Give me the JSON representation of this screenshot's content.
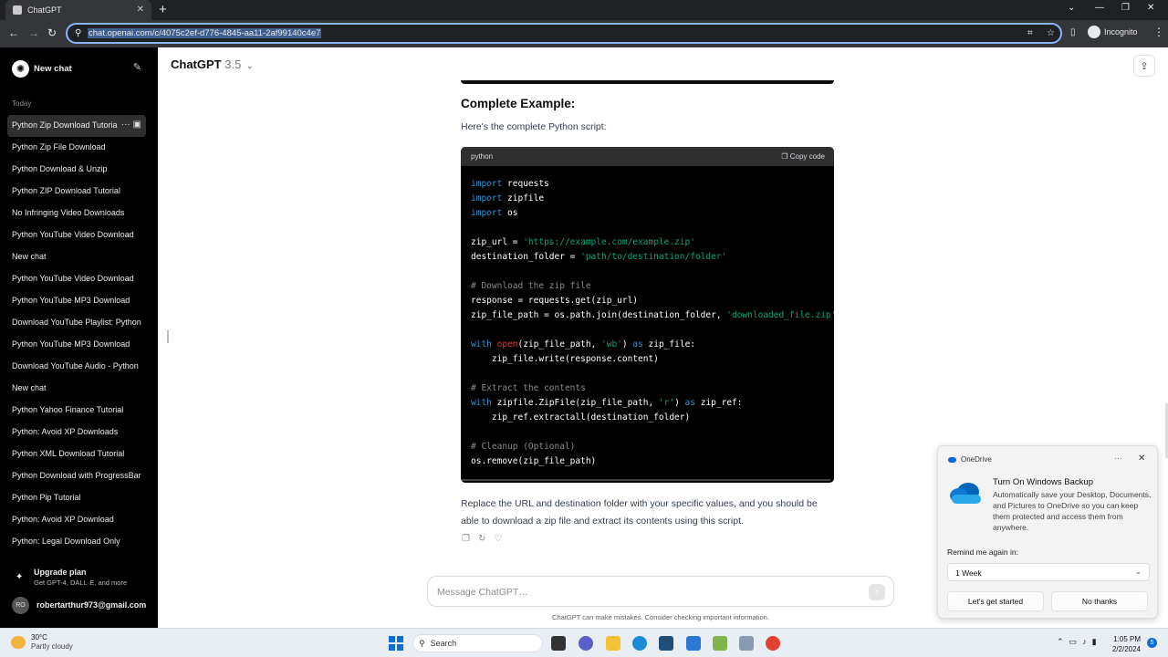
{
  "browser": {
    "tab_title": "ChatGPT",
    "url": "chat.openai.com/c/4075c2ef-d776-4845-aa11-2af99140c4e7",
    "profile_label": "Incognito"
  },
  "sidebar": {
    "new_chat_label": "New chat",
    "section_label": "Today",
    "items": [
      {
        "label": "Python Zip Download Tutorial"
      },
      {
        "label": "Python Zip File Download"
      },
      {
        "label": "Python Download & Unzip"
      },
      {
        "label": "Python ZIP Download Tutorial"
      },
      {
        "label": "No Infringing Video Downloads"
      },
      {
        "label": "Python YouTube Video Download"
      },
      {
        "label": "New chat"
      },
      {
        "label": "Python YouTube Video Download"
      },
      {
        "label": "Python YouTube MP3 Download"
      },
      {
        "label": "Download YouTube Playlist: Python"
      },
      {
        "label": "Python YouTube MP3 Download"
      },
      {
        "label": "Download YouTube Audio - Python"
      },
      {
        "label": "New chat"
      },
      {
        "label": "Python Yahoo Finance Tutorial"
      },
      {
        "label": "Python: Avoid XP Downloads"
      },
      {
        "label": "Python XML Download Tutorial"
      },
      {
        "label": "Python Download with ProgressBar"
      },
      {
        "label": "Python Pip Tutorial"
      },
      {
        "label": "Python: Avoid XP Download"
      },
      {
        "label": "Python: Legal Download Only"
      }
    ],
    "upgrade_title": "Upgrade plan",
    "upgrade_sub": "Get GPT-4, DALL·E, and more",
    "user_initials": "RO",
    "user_email": "robertarthur973@gmail.com"
  },
  "header": {
    "model_name": "ChatGPT",
    "model_version": "3.5"
  },
  "message": {
    "section_title": "Complete Example:",
    "intro": "Here's the complete Python script:",
    "code_lang": "python",
    "copy_label": "Copy code",
    "outro": "Replace the URL and destination folder with your specific values, and you should be able to download a zip file and extract its contents using this script."
  },
  "composer": {
    "placeholder": "Message ChatGPT…",
    "disclaimer": "ChatGPT can make mistakes. Consider checking important information."
  },
  "onedrive": {
    "app_name": "OneDrive",
    "title": "Turn On Windows Backup",
    "description": "Automatically save your Desktop, Documents, and Pictures to OneDrive so you can keep them protected and access them from anywhere.",
    "remind_label": "Remind me again in:",
    "remind_value": "1 Week",
    "primary_button": "Let's get started",
    "secondary_button": "No thanks"
  },
  "taskbar": {
    "temperature": "30°C",
    "weather": "Partly cloudy",
    "search_label": "Search",
    "time": "1:05 PM",
    "date": "2/2/2024",
    "notification_count": "5"
  },
  "colors": {
    "sidebar_bg": "#000000",
    "code_keyword": "#2e95d3",
    "code_string": "#00a67d",
    "code_comment": "#8b8b8b",
    "accent_blue": "#0f6cd4"
  }
}
